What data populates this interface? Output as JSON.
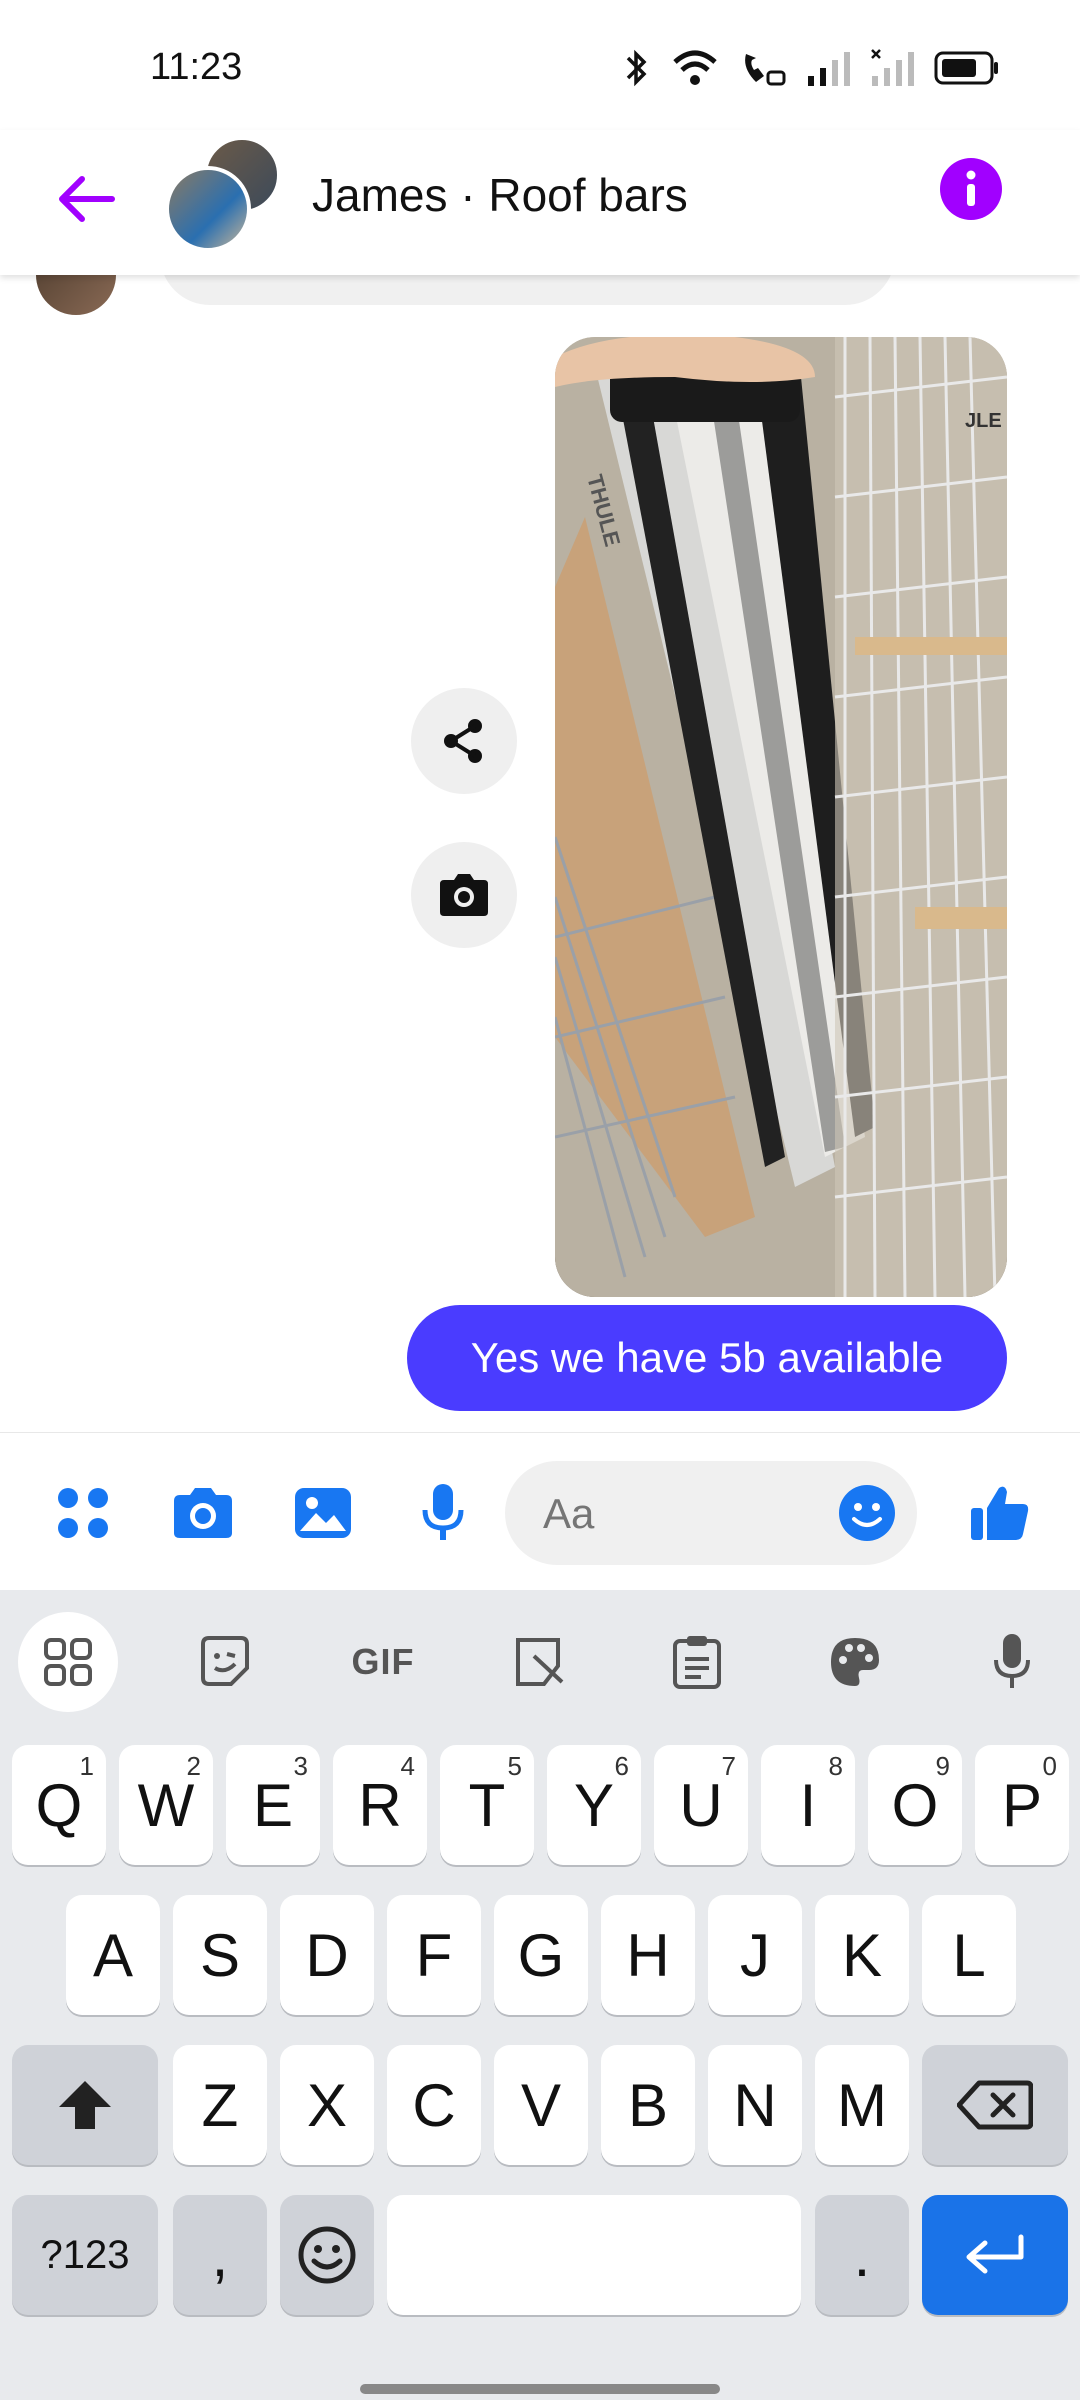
{
  "status": {
    "time": "11:23"
  },
  "header": {
    "title": "James · Roof bars",
    "accent_color": "#a100ff"
  },
  "chat": {
    "sent_message": "Yes we have 5b available",
    "bubble_color": "#4a3cff",
    "photo_label": "THULE",
    "photo_label_2": "JLE"
  },
  "composer": {
    "placeholder": "Aa",
    "accent_color": "#1877f2"
  },
  "keyboard": {
    "toolbar_gif": "GIF",
    "row1": [
      {
        "key": "Q",
        "num": "1"
      },
      {
        "key": "W",
        "num": "2"
      },
      {
        "key": "E",
        "num": "3"
      },
      {
        "key": "R",
        "num": "4"
      },
      {
        "key": "T",
        "num": "5"
      },
      {
        "key": "Y",
        "num": "6"
      },
      {
        "key": "U",
        "num": "7"
      },
      {
        "key": "I",
        "num": "8"
      },
      {
        "key": "O",
        "num": "9"
      },
      {
        "key": "P",
        "num": "0"
      }
    ],
    "row2": [
      "A",
      "S",
      "D",
      "F",
      "G",
      "H",
      "J",
      "K",
      "L"
    ],
    "row3": [
      "Z",
      "X",
      "C",
      "V",
      "B",
      "N",
      "M"
    ],
    "symbols_key": "?123",
    "comma_key": ",",
    "period_key": "."
  }
}
